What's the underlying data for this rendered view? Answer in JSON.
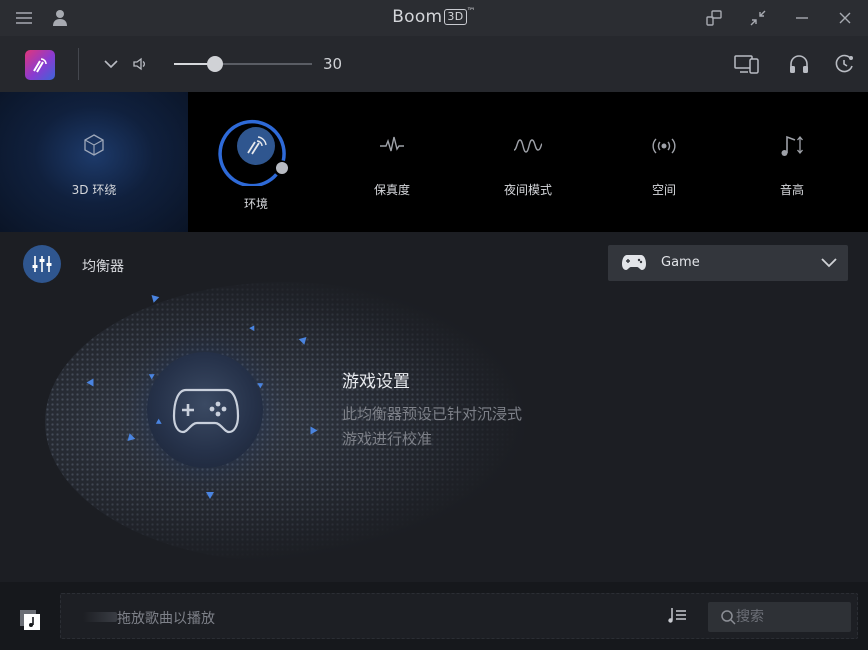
{
  "app": {
    "name": "Boom",
    "name_badge": "3D",
    "trademark": "™"
  },
  "volume": {
    "value": "30",
    "level": 0.3
  },
  "effects": [
    {
      "label": "3D 环绕",
      "icon": "cube-icon",
      "active": true
    },
    {
      "label": "环境",
      "icon": "ambience-icon"
    },
    {
      "label": "保真度",
      "icon": "fidelity-wave-icon"
    },
    {
      "label": "夜间模式",
      "icon": "night-mode-wave-icon"
    },
    {
      "label": "空间",
      "icon": "spatial-icon"
    },
    {
      "label": "音高",
      "icon": "pitch-icon"
    }
  ],
  "equalizer": {
    "title": "均衡器",
    "preset": "Game"
  },
  "preset_info": {
    "title": "游戏设置",
    "description": "此均衡器预设已针对沉浸式游戏进行校准"
  },
  "bottom": {
    "drop_hint": "拖放歌曲以播放",
    "search_placeholder": "搜索"
  },
  "colors": {
    "accent": "#2f568f",
    "active_tile": "#10203d",
    "background": "#1c1e23"
  }
}
